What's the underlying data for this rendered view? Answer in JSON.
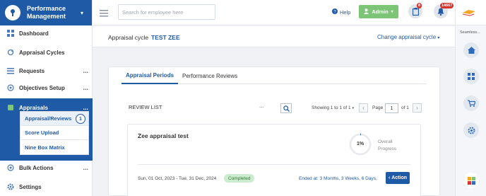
{
  "brand": {
    "title": "Performance Management"
  },
  "sidebar": {
    "items": [
      {
        "label": "Dashboard",
        "icon": "grid-icon"
      },
      {
        "label": "Appraisal Cycles",
        "icon": "refresh-icon"
      },
      {
        "label": "Requests",
        "icon": "list-icon"
      },
      {
        "label": "Objectives Setup",
        "icon": "target-icon"
      },
      {
        "label": "Appraisals",
        "icon": "book-icon"
      },
      {
        "label": "Bulk Actions",
        "icon": "target-icon"
      },
      {
        "label": "Settings",
        "icon": "gear-icon"
      }
    ],
    "submenu": [
      {
        "label": "Appraisal/Reviews"
      },
      {
        "label": "Score Upload"
      },
      {
        "label": "Nine Box Matrix"
      }
    ],
    "submenu_badge": "1"
  },
  "topbar": {
    "search_placeholder": "Search for employee here",
    "help": "Help",
    "admin": "Admin",
    "clipboard_badge": "8",
    "bell_badge": "14667"
  },
  "rail": {
    "label": "Seamless..."
  },
  "cycle": {
    "label": "Appraisal cycle",
    "name": "TEST ZEE",
    "change": "Change appraisal cycle"
  },
  "tabs": [
    "Appraisal Periods",
    "Performance Reviews"
  ],
  "list": {
    "title": "REVIEW LIST",
    "showing": "Showing 1 to 1 of 1",
    "page_label": "Page",
    "page_value": "1",
    "of_label": "of 1"
  },
  "card": {
    "title": "Zee appraisal test",
    "progress": "1%",
    "progress_fraction": 0.01,
    "progress_label_1": "Overall",
    "progress_label_2": "Progress",
    "dates": "Sun, 01 Oct, 2023 - Tue, 31 Dec, 2024",
    "status": "Completed",
    "ended": "Ended at: 3 Months, 3 Weeks, 6 Days,",
    "action": "Action"
  }
}
